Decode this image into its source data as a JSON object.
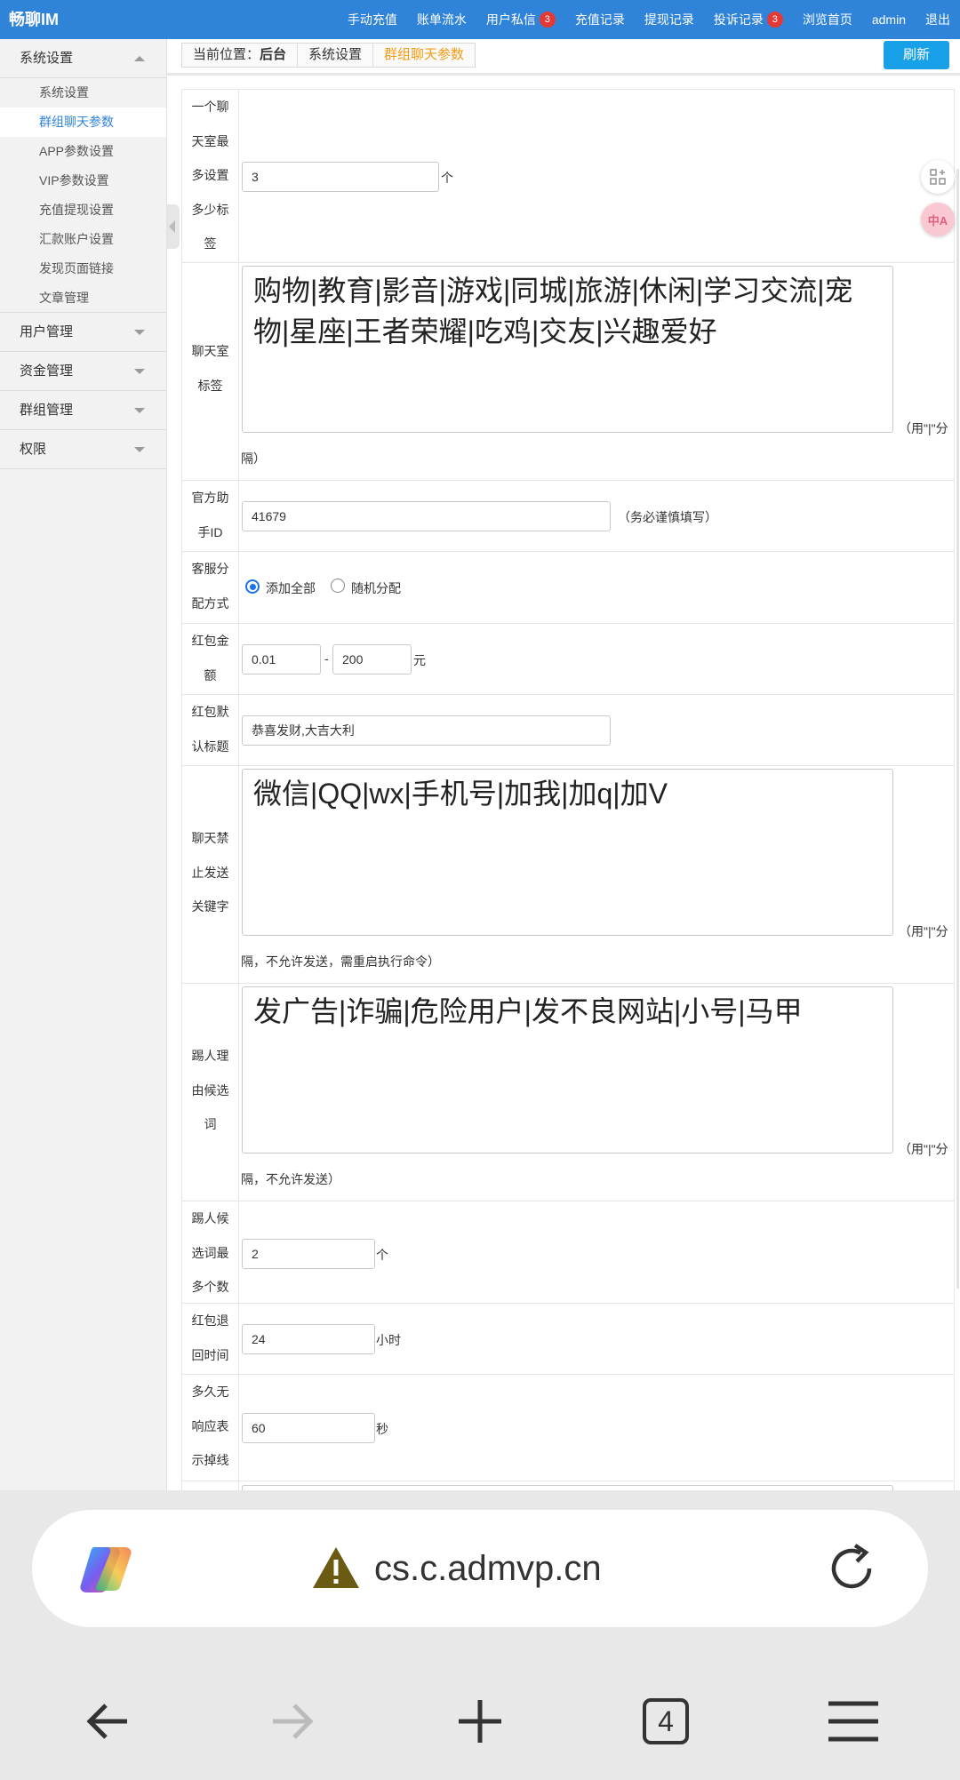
{
  "app": {
    "brand": "畅聊IM"
  },
  "topnav": [
    {
      "label": "手动充值"
    },
    {
      "label": "账单流水"
    },
    {
      "label": "用户私信",
      "badge": "3"
    },
    {
      "label": "充值记录"
    },
    {
      "label": "提现记录"
    },
    {
      "label": "投诉记录",
      "badge": "3"
    },
    {
      "label": "浏览首页"
    },
    {
      "label": "admin"
    },
    {
      "label": "退出"
    }
  ],
  "sidebar": {
    "groups": [
      {
        "label": "系统设置",
        "expanded": true,
        "items": [
          "系统设置",
          "群组聊天参数",
          "APP参数设置",
          "VIP参数设置",
          "充值提现设置",
          "汇款账户设置",
          "发现页面链接",
          "文章管理"
        ],
        "active_index": 1
      },
      {
        "label": "用户管理",
        "expanded": false
      },
      {
        "label": "资金管理",
        "expanded": false
      },
      {
        "label": "群组管理",
        "expanded": false
      },
      {
        "label": "权限",
        "expanded": false
      }
    ]
  },
  "breadcrumb": {
    "prefix": "当前位置：",
    "home": "后台",
    "parent": "系统设置",
    "current": "群组聊天参数"
  },
  "toolbar": {
    "refresh_label": "刷新"
  },
  "form": {
    "max_tags": {
      "label": "一个聊天室最多设置多少标签",
      "value": "3",
      "unit": "个"
    },
    "room_tags": {
      "label": "聊天室标签",
      "value": "购物|教育|影音|游戏|同城|旅游|休闲|学习交流|宠物|星座|王者荣耀|吃鸡|交友|兴趣爱好",
      "note1": "（用\"|\"分",
      "note2": "隔）"
    },
    "assistant_id": {
      "label": "官方助手ID",
      "value": "41679",
      "note": "（务必谨慎填写）"
    },
    "service_mode": {
      "label": "客服分配方式",
      "options": [
        "添加全部",
        "随机分配"
      ],
      "selected": 0
    },
    "red_amount": {
      "label": "红包金额",
      "min": "0.01",
      "sep": "-",
      "max": "200",
      "unit": "元"
    },
    "red_title": {
      "label": "红包默认标题",
      "value": "恭喜发财,大吉大利"
    },
    "banned_words": {
      "label": "聊天禁止发送关键字",
      "value": "微信|QQ|wx|手机号|加我|加q|加V",
      "note1": "（用\"|\"分",
      "note2": "隔，不允许发送，需重启执行命令）"
    },
    "kick_reasons": {
      "label": "踢人理由候选词",
      "value": "发广告|诈骗|危险用户|发不良网站|小号|马甲",
      "note1": "（用\"|\"分",
      "note2": "隔，不允许发送）"
    },
    "kick_max": {
      "label": "踢人候选词最多个数",
      "value": "2",
      "unit": "个"
    },
    "red_return": {
      "label": "红包退回时间",
      "value": "24",
      "unit": "小时"
    },
    "offline_timeout": {
      "label": "多久无响应表示掉线",
      "value": "60",
      "unit": "秒"
    }
  },
  "side_fabs": {
    "fab2": "中A"
  },
  "browser": {
    "url": "cs.c.admvp.cn",
    "tab_count": "4"
  }
}
